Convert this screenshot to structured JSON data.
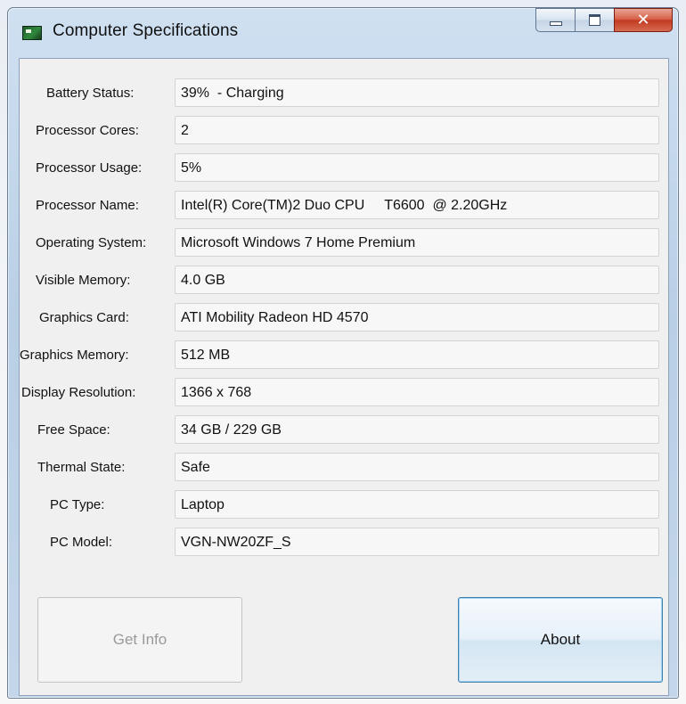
{
  "window": {
    "title": "Computer Specifications"
  },
  "fields": [
    {
      "label": "Battery Status:",
      "value": "39%  - Charging"
    },
    {
      "label": "Processor Cores:",
      "value": "2"
    },
    {
      "label": "Processor Usage:",
      "value": "5%"
    },
    {
      "label": "Processor Name:",
      "value": "Intel(R) Core(TM)2 Duo CPU     T6600  @ 2.20GHz"
    },
    {
      "label": "Operating System:",
      "value": "Microsoft Windows 7 Home Premium"
    },
    {
      "label": "Visible Memory:",
      "value": "4.0 GB"
    },
    {
      "label": "Graphics Card:",
      "value": "ATI Mobility Radeon HD 4570"
    },
    {
      "label": "Graphics Memory:",
      "value": "512 MB"
    },
    {
      "label": "Display Resolution:",
      "value": "1366 x 768"
    },
    {
      "label": "Free Space:",
      "value": "34 GB / 229 GB"
    },
    {
      "label": "Thermal State:",
      "value": "Safe"
    },
    {
      "label": "PC Type:",
      "value": "Laptop"
    },
    {
      "label": "PC Model:",
      "value": "VGN-NW20ZF_S"
    }
  ],
  "buttons": {
    "get_info": "Get Info",
    "about": "About"
  },
  "icons": {
    "app": "computer-specs-app-icon",
    "minimize": "minimize-icon",
    "maximize": "maximize-icon",
    "close": "close-icon"
  }
}
